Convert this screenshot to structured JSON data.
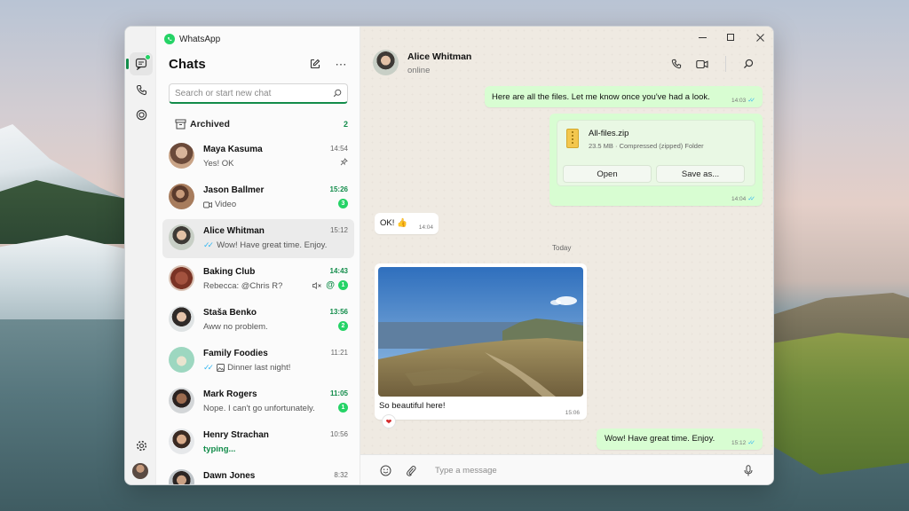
{
  "app": {
    "title": "WhatsApp",
    "accent": "#128c4a",
    "badge_color": "#25d366"
  },
  "rail": {
    "items": [
      {
        "icon": "chats-icon",
        "active": true
      },
      {
        "icon": "calls-icon",
        "active": false
      },
      {
        "icon": "status-icon",
        "active": false
      }
    ],
    "bottom": [
      {
        "icon": "settings-icon"
      },
      {
        "icon": "profile-avatar"
      }
    ]
  },
  "list": {
    "title": "Chats",
    "new_chat_icon": "compose-icon",
    "menu_icon": "more-icon",
    "search_placeholder": "Search or start new chat",
    "archived": {
      "label": "Archived",
      "count": "2"
    },
    "chats": [
      {
        "name": "Maya Kasuma",
        "time": "14:54",
        "preview": "Yes! OK",
        "pinned": true,
        "unread": ""
      },
      {
        "name": "Jason Ballmer",
        "time": "15:26",
        "preview": "Video",
        "preview_icon": "video-icon",
        "unread": "3"
      },
      {
        "name": "Alice Whitman",
        "time": "15:12",
        "preview": "Wow! Have great time. Enjoy.",
        "ticks": true,
        "selected": true,
        "unread": ""
      },
      {
        "name": "Baking Club",
        "time": "14:43",
        "preview": "Rebecca: @Chris R?",
        "muted": true,
        "mention": "@",
        "unread": "1"
      },
      {
        "name": "Staša Benko",
        "time": "13:56",
        "preview": "Aww no problem.",
        "unread": "2"
      },
      {
        "name": "Family Foodies",
        "time": "11:21",
        "preview": "Dinner last night!",
        "ticks": true,
        "preview_icon": "image-icon",
        "unread": ""
      },
      {
        "name": "Mark Rogers",
        "time": "11:05",
        "preview": "Nope. I can't go unfortunately.",
        "unread": "1"
      },
      {
        "name": "Henry Strachan",
        "time": "10:56",
        "preview": "typing...",
        "typing": true,
        "unread": ""
      },
      {
        "name": "Dawn Jones",
        "time": "8:32",
        "preview": "",
        "unread": ""
      }
    ]
  },
  "conversation": {
    "contact": {
      "name": "Alice Whitman",
      "status": "online"
    },
    "header_icons": [
      "phone-icon",
      "video-call-icon",
      "search-icon"
    ],
    "window_controls": [
      "minimize-icon",
      "maximize-icon",
      "close-icon"
    ],
    "messages": [
      {
        "type": "out",
        "text": "Here are all the files. Let me know once you've had a look.",
        "time": "14:03"
      },
      {
        "type": "out-file",
        "file_name": "All-files.zip",
        "file_meta": "23.5 MB · Compressed (zipped) Folder",
        "open_label": "Open",
        "save_label": "Save as...",
        "time": "14:04"
      },
      {
        "type": "in",
        "text": "OK! 👍",
        "time": "14:04"
      },
      {
        "type": "date",
        "text": "Today"
      },
      {
        "type": "in-photo",
        "caption": "So beautiful here!",
        "time": "15:06",
        "reaction": "❤"
      },
      {
        "type": "out",
        "text": "Wow! Have great time. Enjoy.",
        "time": "15:12"
      }
    ],
    "composer": {
      "placeholder": "Type a message",
      "icons": [
        "emoji-icon",
        "attach-icon",
        "mic-icon"
      ]
    }
  }
}
